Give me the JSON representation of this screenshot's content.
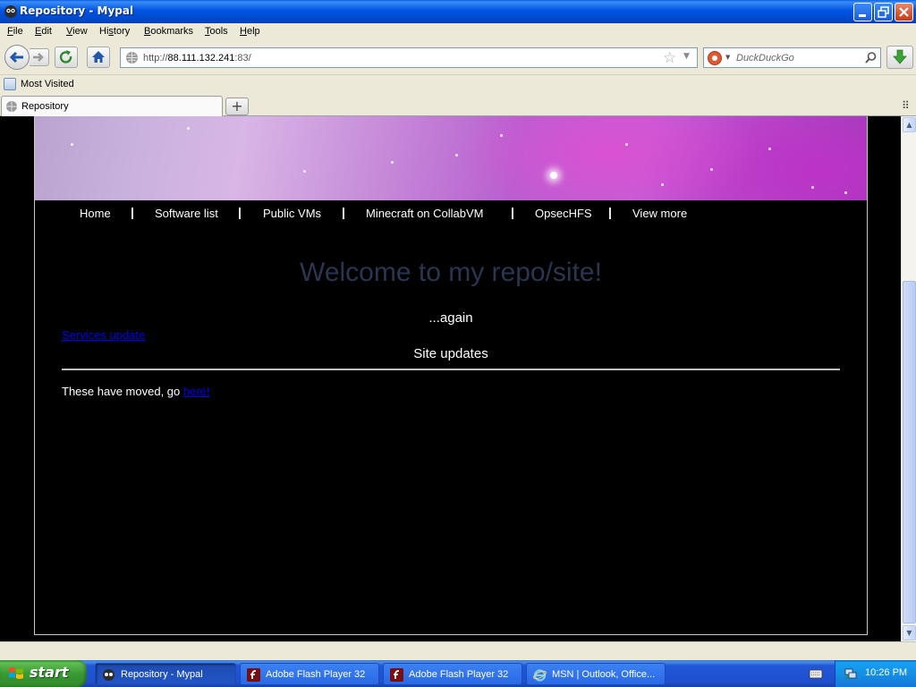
{
  "window": {
    "title": "Repository - Mypal",
    "minimize_label": "_",
    "maximize_label": "❐",
    "close_label": "✕"
  },
  "menubar": {
    "items": [
      {
        "key": "F",
        "rest": "ile"
      },
      {
        "key": "E",
        "rest": "dit"
      },
      {
        "key": "V",
        "rest": "iew"
      },
      {
        "key": "",
        "label_pre": "Hi",
        "key2": "s",
        "rest": "tory"
      },
      {
        "key": "B",
        "rest": "ookmarks"
      },
      {
        "key": "T",
        "rest": "ools"
      },
      {
        "key": "H",
        "rest": "elp"
      }
    ]
  },
  "navbar": {
    "url_scheme": "http://",
    "url_host": "88.111.132.241",
    "url_rest": ":83/",
    "search_placeholder": "DuckDuckGo"
  },
  "bookmarks": {
    "items": [
      "Most Visited"
    ]
  },
  "tabs": {
    "items": [
      {
        "label": "Repository",
        "active": true
      }
    ],
    "new_tab_label": "+"
  },
  "site": {
    "nav": [
      "Home",
      "Software list",
      "Public VMs",
      "Minecraft on CollabVM",
      "OpsecHFS",
      "View more"
    ],
    "nav_separator": "|",
    "welcome": "Welcome to my repo/site!",
    "again": "...again",
    "services_link": "Services update",
    "updates_title": "Site updates",
    "moved_text": "These have moved, go ",
    "moved_link": "here!"
  },
  "taskbar": {
    "start_label": "start",
    "tasks": [
      {
        "label": "Repository - Mypal",
        "active": true,
        "icon": "mypal-icon"
      },
      {
        "label": "Adobe Flash Player 32",
        "active": false,
        "icon": "flash-icon"
      },
      {
        "label": "Adobe Flash Player 32",
        "active": false,
        "icon": "flash-icon"
      },
      {
        "label": "MSN | Outlook, Office...",
        "active": false,
        "icon": "ie-icon"
      }
    ],
    "clock": "10:26 PM"
  },
  "colors": {
    "title_blue": "#0054e3",
    "page_bg": "#000000",
    "welcome_text": "#2a3550",
    "link": "#0000ee",
    "taskbar_blue": "#2157d7",
    "start_green": "#3a9a32"
  }
}
